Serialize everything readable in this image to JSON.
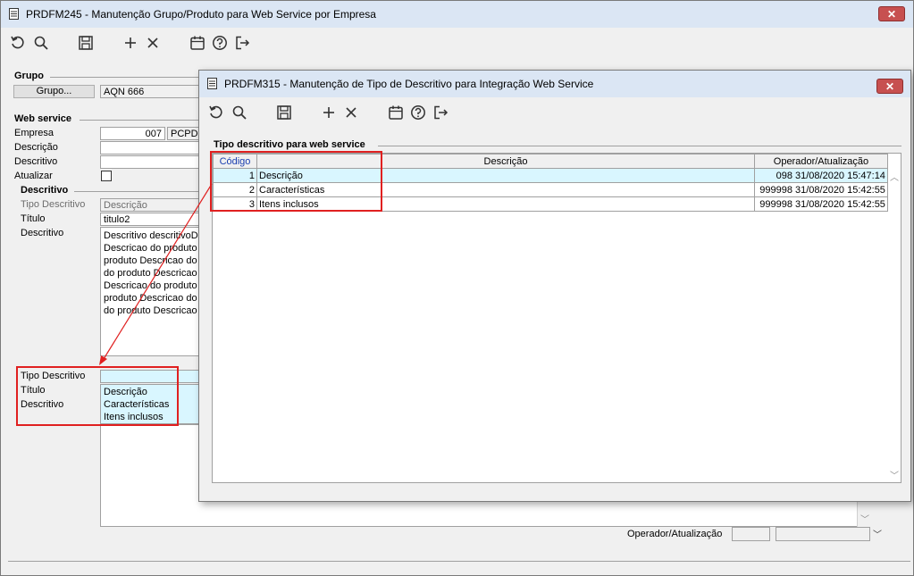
{
  "main_window": {
    "title": "PRDFM245 - Manutenção Grupo/Produto para Web Service por Empresa",
    "close_label": "✕",
    "grupo": {
      "section_label": "Grupo",
      "button_label": "Grupo...",
      "value": "AQN 666"
    },
    "web_service": {
      "section_label": "Web service",
      "empresa_label": "Empresa",
      "empresa_code": "007",
      "empresa_name": "PCPDE",
      "descricao_label": "Descrição",
      "descritivo_label": "Descritivo",
      "atualizar_label": "Atualizar"
    },
    "descritivo": {
      "section_label": "Descritivo",
      "tipo_label": "Tipo Descritivo",
      "tipo_placeholder": "Descrição",
      "titulo_label": "Título",
      "titulo_value": "titulo2",
      "descritivo_label": "Descritivo",
      "memo_lines": [
        "Descritivo descritivoDe",
        "Descricao do produto I",
        "produto Descricao do p",
        "do produto Descricao d",
        "Descricao do produto I",
        "produto Descricao do p",
        "do produto Descricao d"
      ]
    },
    "lower": {
      "tipo_label": "Tipo Descritivo",
      "titulo_label": "Título",
      "descritivo_label": "Descritivo",
      "dropdown_options": [
        "Descrição",
        "Características",
        "Itens inclusos"
      ]
    },
    "operador_label": "Operador/Atualização"
  },
  "dialog": {
    "title": "PRDFM315 - Manutenção de Tipo de Descritivo para Integração Web Service",
    "close_label": "✕",
    "section_label": "Tipo descritivo para web service",
    "columns": [
      "Código",
      "Descrição",
      "Operador/Atualização"
    ],
    "rows": [
      {
        "codigo": "1",
        "descricao": "Descrição",
        "operador": "098",
        "data": "31/08/2020 15:47:14"
      },
      {
        "codigo": "2",
        "descricao": "Características",
        "operador": "999998",
        "data": "31/08/2020 15:42:55"
      },
      {
        "codigo": "3",
        "descricao": "Itens inclusos",
        "operador": "999998",
        "data": "31/08/2020 15:42:55"
      }
    ]
  },
  "colors": {
    "highlight": "#d9f6ff",
    "annotation_red": "#e02020",
    "close_red": "#c75050",
    "titlebar": "#dbe6f4"
  }
}
